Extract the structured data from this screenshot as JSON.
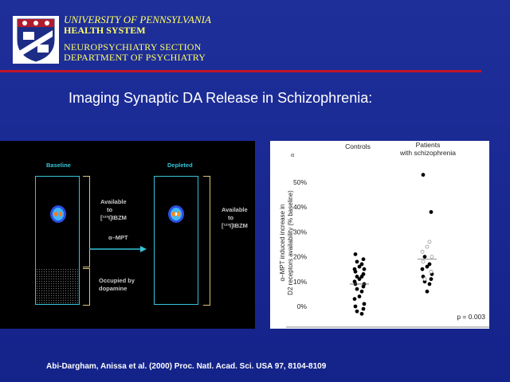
{
  "header": {
    "university": "UNIVERSITY OF PENNSYLVANIA",
    "health_system": "HEALTH SYSTEM",
    "section": "NEUROPSYCHIATRY SECTION",
    "department": "DEPARTMENT OF PSYCHIATRY",
    "accent_color": "#c0152a",
    "text_color": "#ffff66"
  },
  "slide": {
    "title": "Imaging Synaptic DA Release in Schizophrenia:",
    "citation": "Abi-Dargham, Anissa et al. (2000) Proc. Natl. Acad. Sci. USA 97, 8104-8109"
  },
  "diagram": {
    "baseline_label": "Baseline",
    "depleted_label": "Depleted",
    "available_label_1": "Available",
    "available_label_2": "to",
    "available_label_3": "[¹²³I]IBZM",
    "arrow_label": "α–MPT",
    "occupied_label_1": "Occupied by",
    "occupied_label_2": "dopamine"
  },
  "plot": {
    "alpha_label": "α",
    "group_controls": "Controls",
    "group_patients_1": "Patients",
    "group_patients_2": "with schizophrenia",
    "ylabel_1": "α–MPT induced increase in",
    "ylabel_2": "D2 receptors availability (% baseline)",
    "yticks": [
      "50%",
      "40%",
      "30%",
      "20%",
      "10%",
      "0%"
    ],
    "p_value": "p = 0.003",
    "ylim": [
      -5,
      55
    ],
    "controls": [
      21,
      19,
      18,
      17,
      16,
      15,
      15,
      14,
      13,
      12,
      12,
      11,
      10,
      9,
      9,
      8,
      7,
      6,
      4,
      3,
      1,
      0,
      -1,
      -2,
      -3
    ],
    "controls_mean": 9,
    "patients_filled": [
      53,
      38,
      20,
      17,
      16,
      15,
      13,
      12,
      11,
      10,
      9,
      6
    ],
    "patients_open": [
      26,
      24,
      22,
      20,
      18,
      14,
      11
    ],
    "patients_mean": 19
  }
}
